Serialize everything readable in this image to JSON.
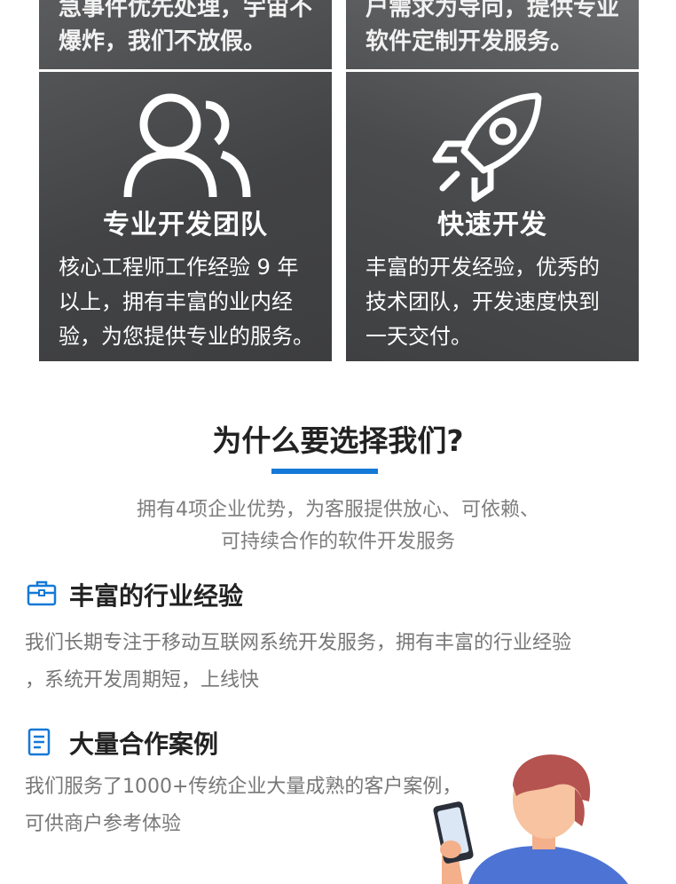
{
  "cards": [
    {
      "top_text_lines": [
        "急事件优先处理，宇宙不",
        "爆炸，我们不放假。"
      ],
      "icon": "team-icon",
      "title": "专业开发团队",
      "desc_lines": [
        "核心工程师工作经验 9 年",
        "以上，拥有丰富的业内经",
        "验，为您提供专业的服务。"
      ]
    },
    {
      "top_text_lines": [
        "户需求为导向，提供专业",
        "软件定制开发服务。"
      ],
      "icon": "rocket-icon",
      "title": "快速开发",
      "desc_lines": [
        "丰富的开发经验，优秀的",
        "技术团队，开发速度快到",
        "一天交付。"
      ]
    }
  ],
  "why": {
    "heading": "为什么要选择我们?",
    "sub_line1": "拥有4项企业优势，为客服提供放心、可依赖、",
    "sub_line2": "可持续合作的软件开发服务",
    "accent_color": "#1479d7"
  },
  "features": [
    {
      "icon": "briefcase-icon",
      "title": "丰富的行业经验",
      "text_line1": "我们长期专注于移动互联网系统开发服务，拥有丰富的行业经验",
      "text_line2": "，系统开发周期短，上线快"
    },
    {
      "icon": "document-icon",
      "title": "大量合作案例",
      "text_line1": "我们服务了1000+传统企业大量成熟的客户案例，",
      "text_line2": "可供商户参考体验"
    }
  ],
  "illustration": "person-with-phone-icon"
}
